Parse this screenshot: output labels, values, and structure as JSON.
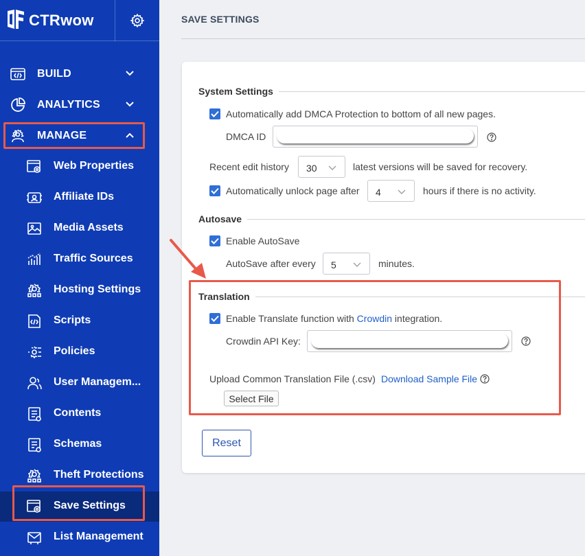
{
  "brand": {
    "name": "CTRwow",
    "logo_icon": "ctrwow-logo-icon",
    "settings_icon": "gear-icon"
  },
  "nav": {
    "top": [
      {
        "label": "BUILD",
        "icon": "code-window-icon",
        "expanded": false
      },
      {
        "label": "ANALYTICS",
        "icon": "pie-chart-icon",
        "expanded": false
      },
      {
        "label": "MANAGE",
        "icon": "gear-person-icon",
        "expanded": true
      }
    ],
    "manage_items": [
      {
        "label": "Web Properties",
        "icon": "web-gear-icon"
      },
      {
        "label": "Affiliate IDs",
        "icon": "id-card-icon"
      },
      {
        "label": "Media Assets",
        "icon": "image-icon"
      },
      {
        "label": "Traffic Sources",
        "icon": "bar-chart-icon"
      },
      {
        "label": "Hosting Settings",
        "icon": "network-gear-icon"
      },
      {
        "label": "Scripts",
        "icon": "script-icon"
      },
      {
        "label": "Policies",
        "icon": "policies-icon"
      },
      {
        "label": "User Managem...",
        "icon": "users-icon"
      },
      {
        "label": "Contents",
        "icon": "document-icon"
      },
      {
        "label": "Schemas",
        "icon": "schema-icon"
      },
      {
        "label": "Theft Protections",
        "icon": "shield-gear-icon"
      },
      {
        "label": "Save Settings",
        "icon": "save-gear-icon",
        "active": true
      },
      {
        "label": "List Management",
        "icon": "mail-list-icon"
      }
    ]
  },
  "page": {
    "title": "SAVE SETTINGS"
  },
  "system": {
    "title": "System Settings",
    "dmca_checkbox": {
      "label": "Automatically add DMCA Protection to bottom of all new pages.",
      "checked": true
    },
    "dmca_id": {
      "label": "DMCA ID",
      "value": ""
    },
    "history": {
      "prefix": "Recent edit history",
      "value": "30",
      "suffix": "latest versions will be saved for recovery."
    },
    "unlock": {
      "prefix": "Automatically unlock page after",
      "value": "4",
      "suffix": "hours if there is no activity.",
      "checked": true
    }
  },
  "autosave": {
    "title": "Autosave",
    "enable": {
      "label": "Enable AutoSave",
      "checked": true
    },
    "every": {
      "prefix": "AutoSave after every",
      "value": "5",
      "suffix": "minutes."
    }
  },
  "translation": {
    "title": "Translation",
    "enable": {
      "label_before": "Enable Translate function with ",
      "link": "Crowdin",
      "label_after": " integration.",
      "checked": true
    },
    "api_key": {
      "label": "Crowdin API Key:",
      "value": ""
    },
    "upload": {
      "label": "Upload Common Translation File (.csv)",
      "sample_link": "Download Sample File",
      "button": "Select File"
    }
  },
  "actions": {
    "reset": "Reset"
  },
  "colors": {
    "sidebar": "#0f3cb4",
    "active": "#0a2a7c",
    "accent": "#2f6fd6",
    "highlight": "#e8594a"
  }
}
